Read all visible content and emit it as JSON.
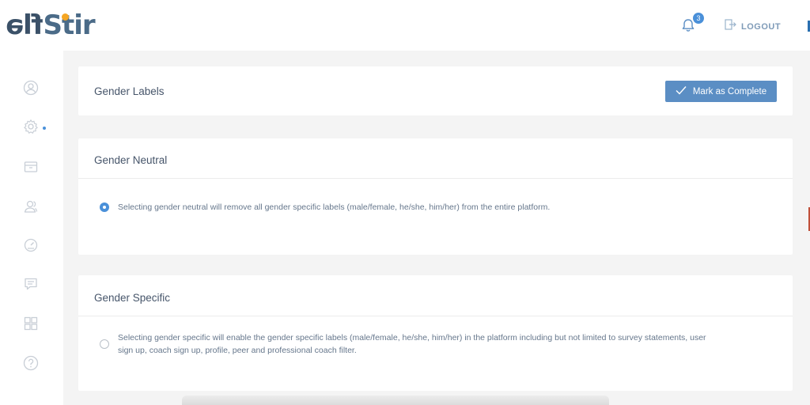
{
  "brand": {
    "logo_flipped": "flə",
    "logo_main": "Stir"
  },
  "header": {
    "notifications_count": "3",
    "logout_label": "LOGOUT"
  },
  "sidebar": {
    "items": [
      {
        "icon": "user-circle-icon"
      },
      {
        "icon": "gear-icon",
        "active_dot": true
      },
      {
        "icon": "archive-box-icon"
      },
      {
        "icon": "users-icon"
      },
      {
        "icon": "gauge-icon"
      },
      {
        "icon": "chat-icon"
      },
      {
        "icon": "grid-icon"
      },
      {
        "icon": "help-icon"
      }
    ]
  },
  "labels_card": {
    "title": "Gender Labels",
    "mark_complete_label": "Mark as Complete"
  },
  "neutral_card": {
    "title": "Gender Neutral",
    "description": "Selecting gender neutral will remove all gender specific labels (male/female, he/she, him/her) from the entire platform.",
    "selected": true
  },
  "specific_card": {
    "title": "Gender Specific",
    "description_line1": "Selecting gender specific will enable the gender specific labels (male/female, he/she, him/her) in the platform including but not limited to survey statements, user",
    "description_line2": "sign up, coach sign up, profile, peer and professional coach filter.",
    "selected": false
  },
  "colors": {
    "accent": "#4a90d9",
    "button": "#5b8ec4",
    "logo_orange": "#f5a623",
    "logo_dark": "#3b5168"
  }
}
